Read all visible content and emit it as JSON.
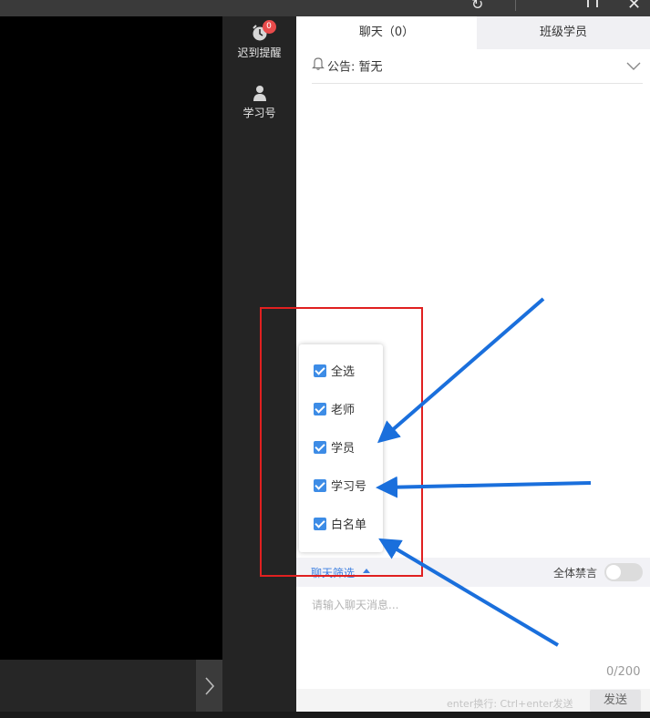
{
  "window": {
    "controls": [
      "refresh-icon",
      "minimize-icon",
      "maximize-icon",
      "close-icon"
    ]
  },
  "tools": {
    "late_reminder": {
      "label": "迟到提醒",
      "badge": "0",
      "icon": "alarm-clock-icon"
    },
    "student_id": {
      "label": "学习号",
      "icon": "person-icon"
    }
  },
  "tabs": {
    "chat": "聊天（0）",
    "students": "班级学员"
  },
  "notice": {
    "text": "公告: 暂无"
  },
  "filter": {
    "label": "聊天筛选",
    "options": [
      {
        "label": "全选",
        "checked": true
      },
      {
        "label": "老师",
        "checked": true
      },
      {
        "label": "学员",
        "checked": true
      },
      {
        "label": "学习号",
        "checked": true
      },
      {
        "label": "白名单",
        "checked": true
      }
    ]
  },
  "mute_all": {
    "label": "全体禁言",
    "on": false
  },
  "composer": {
    "placeholder": "请输入聊天消息...",
    "counter": "0/200",
    "hint": "enter换行: Ctrl+enter发送",
    "send_label": "发送"
  },
  "colors": {
    "accent": "#3d8ce6",
    "badge": "#e94b4b",
    "highlight_box": "#e02020",
    "arrow": "#1a6fdc"
  }
}
